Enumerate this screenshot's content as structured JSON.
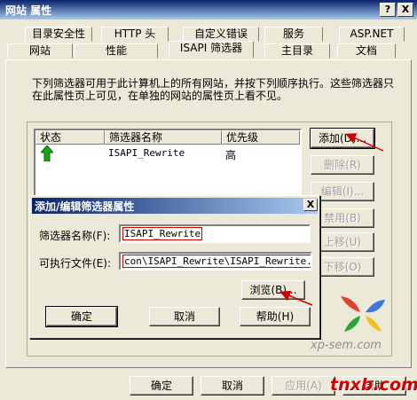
{
  "window": {
    "title": "网站 属性",
    "help_icon": "?",
    "close_icon": "X"
  },
  "tabs_back": [
    {
      "label": "目录安全性"
    },
    {
      "label": "HTTP 头"
    },
    {
      "label": "自定义错误"
    },
    {
      "label": "服务"
    },
    {
      "label": "ASP.NET"
    }
  ],
  "tabs_front": [
    {
      "label": "网站"
    },
    {
      "label": "性能"
    },
    {
      "label": "ISAPI 筛选器"
    },
    {
      "label": "主目录"
    },
    {
      "label": "文档"
    }
  ],
  "description": "下列筛选器可用于此计算机上的所有网站，并按下列顺序执行。这些筛选器只在此属性页上可见，在单独的网站的属性页上看不见。",
  "filter_list": {
    "columns": [
      "状态",
      "筛选器名称",
      "优先级"
    ],
    "rows": [
      {
        "status": "↑",
        "name": "ISAPI_Rewrite",
        "priority": "高"
      }
    ]
  },
  "side_buttons": {
    "add": "添加(D)...",
    "remove": "删除(R)",
    "edit": "编辑(I)...",
    "disable": "禁用(B)",
    "move_up": "上移(U)",
    "move_down": "下移(O)"
  },
  "dialog": {
    "title": "添加/编辑筛选器属性",
    "close_icon": "X",
    "name_label": "筛选器名称(F):",
    "name_value": "ISAPI_Rewrite",
    "exe_label": "可执行文件(E):",
    "exe_value": "con\\ISAPI_Rewrite\\ISAPI_Rewrite.dll",
    "browse": "浏览(B)...",
    "ok": "确定",
    "cancel": "取消",
    "help": "帮助(H)"
  },
  "footer": {
    "ok": "确定",
    "cancel": "取消",
    "apply": "应用(A)",
    "help": "帮助"
  },
  "watermarks": {
    "site": "xp-sem.com",
    "brand": "tnxb.com"
  },
  "colors": {
    "title_bar": "#0a246a",
    "red_highlight": "#d00000",
    "status_arrow": "#1aa31a"
  }
}
